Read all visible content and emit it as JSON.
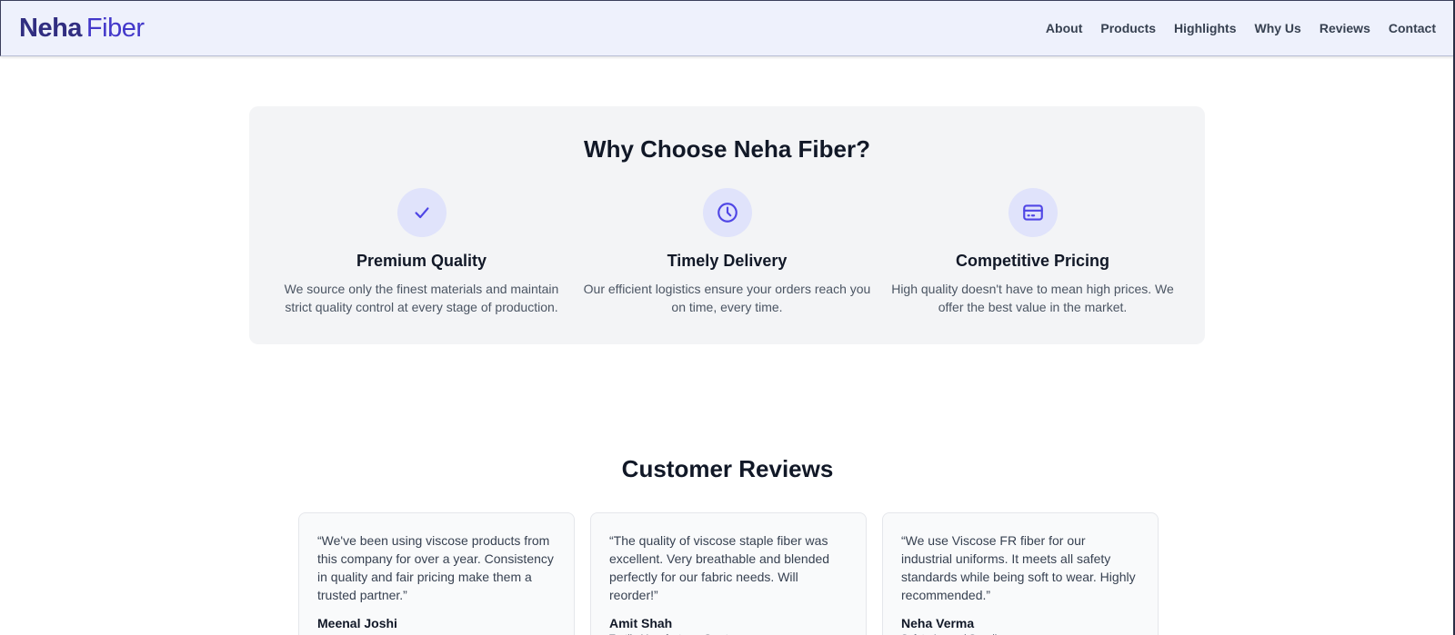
{
  "brand": {
    "strong": "Neha",
    "light": "Fiber"
  },
  "nav": {
    "links": [
      "About",
      "Products",
      "Highlights",
      "Why Us",
      "Reviews",
      "Contact"
    ]
  },
  "why_us": {
    "title": "Why Choose Neha Fiber?",
    "features": [
      {
        "icon": "check-icon",
        "title": "Premium Quality",
        "description": "We source only the finest materials and maintain strict quality control at every stage of production."
      },
      {
        "icon": "clock-icon",
        "title": "Timely Delivery",
        "description": "Our efficient logistics ensure your orders reach you on time, every time."
      },
      {
        "icon": "credit-card-icon",
        "title": "Competitive Pricing",
        "description": "High quality doesn't have to mean high prices. We offer the best value in the market."
      }
    ]
  },
  "reviews": {
    "title": "Customer Reviews",
    "items": [
      {
        "quote": "“We've been using viscose products from this company for over a year. Consistency in quality and fair pricing make them a trusted partner.”",
        "name": "Meenal Joshi",
        "role": ""
      },
      {
        "quote": "“The quality of viscose staple fiber was excellent. Very breathable and blended perfectly for our fabric needs. Will reorder!”",
        "name": "Amit Shah",
        "role": "Textile Manufacturer, Surat"
      },
      {
        "quote": "“We use Viscose FR fiber for our industrial uniforms. It meets all safety standards while being soft to wear. Highly recommended.”",
        "name": "Neha Verma",
        "role": "Safety Apparel Supplier"
      }
    ]
  },
  "colors": {
    "navbar_bg": "#eef1fc",
    "brand": "#312e81",
    "accent": "#4f46e5",
    "icon_circle": "#e0e3fb",
    "section_bg": "#f3f4f6"
  }
}
